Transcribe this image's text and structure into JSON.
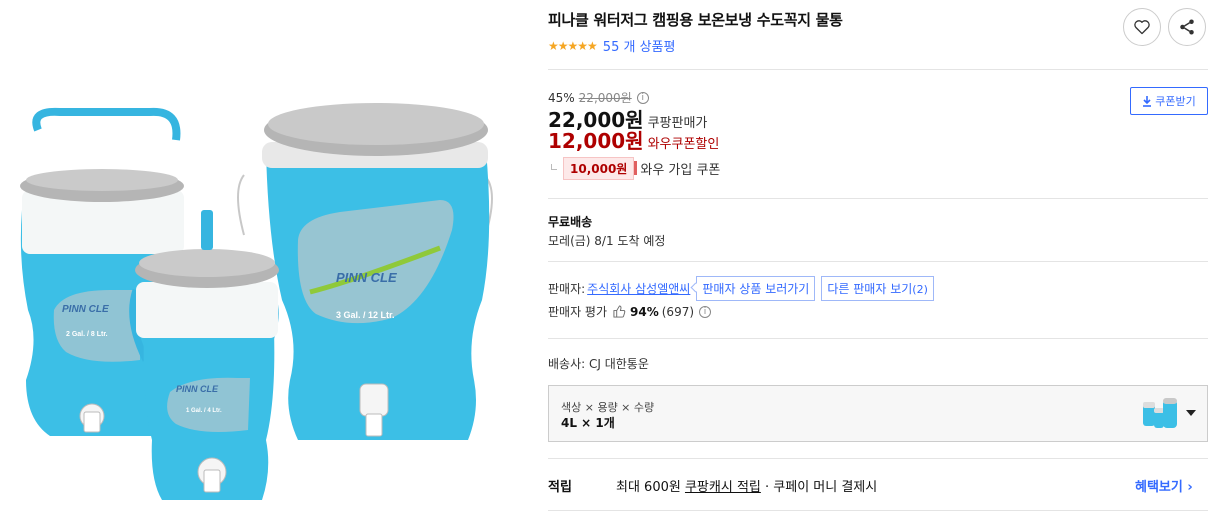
{
  "product": {
    "title": "피나클 워터저그 캠핑용 보온보냉 수도꼭지 물통",
    "stars": "★★★★★",
    "review_count_text": "55 개 상품평",
    "rating_value": 4.5
  },
  "actions": {
    "wishlist_icon": "heart-icon",
    "share_icon": "share-icon"
  },
  "price": {
    "discount_rate": "45%",
    "original_price": "22,000원",
    "info_glyph": "i",
    "sale_price": "22,000원",
    "sale_label": "쿠팡판매가",
    "coupon_price": "12,000원",
    "coupon_label": "와우쿠폰할인",
    "coupon_amount": "10,000원",
    "coupon_desc": "와우 가입 쿠폰",
    "coupon_button": "쿠폰받기"
  },
  "shipping": {
    "title": "무료배송",
    "date": "모레(금) 8/1 도착 예정"
  },
  "seller": {
    "label": "판매자:",
    "name": "주식회사 삼성엘앤씨",
    "view_products": "판매자 상품 보러가기",
    "other_sellers": "다른 판매자 보기",
    "other_count": "(2)",
    "rating_label": "판매자 평가",
    "rating_pct": "94%",
    "rating_count": "(697)",
    "info_glyph": "i"
  },
  "carrier": {
    "text": "배송사: CJ 대한통운"
  },
  "option": {
    "label": "색상 × 용량 × 수량",
    "value": "4L × 1개"
  },
  "reward": {
    "label": "적립",
    "prefix": "최대 600원",
    "link": "쿠팡캐시 적립",
    "suffix": "· 쿠페이 머니 결제시",
    "more": "혜택보기 ›"
  },
  "image_text": {
    "brand_big": "PINN CLE",
    "big_cap": "3 Gal. / 12 Ltr.",
    "brand_small": "PINN CLE",
    "small_cap": "2 Gal. / 8 Ltr.",
    "brand_tiny": "PINN CLE",
    "tiny_cap": "1 Gal. / 4 Ltr."
  },
  "colors": {
    "accent_blue": "#346aff",
    "price_red": "#ae0000",
    "jug_blue": "#33b8e0",
    "star": "#f5a623"
  }
}
